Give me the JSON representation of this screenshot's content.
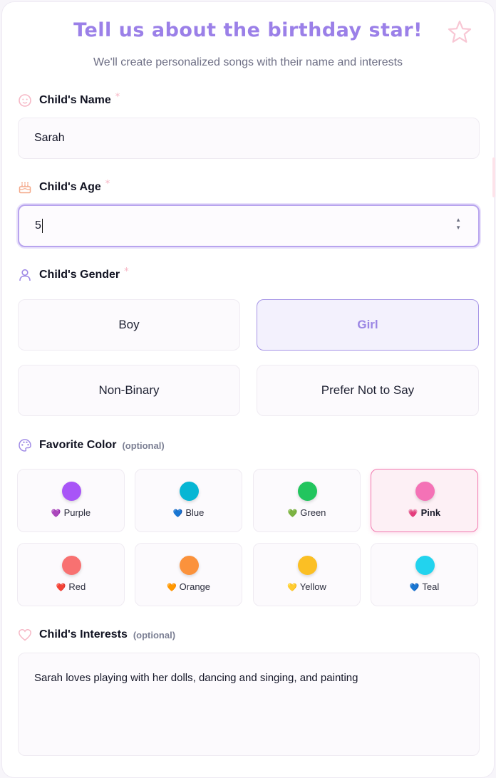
{
  "header": {
    "title": "Tell us about the birthday star!",
    "subtitle": "We'll create personalized songs with their name and interests"
  },
  "name_field": {
    "label": "Child's Name",
    "required_mark": "*",
    "value": "Sarah",
    "icon": "baby-face-icon"
  },
  "age_field": {
    "label": "Child's Age",
    "required_mark": "*",
    "value": "5",
    "icon": "cake-icon"
  },
  "gender_field": {
    "label": "Child's Gender",
    "required_mark": "*",
    "icon": "person-icon",
    "options": [
      "Boy",
      "Girl",
      "Non-Binary",
      "Prefer Not to Say"
    ],
    "selected": "Girl"
  },
  "color_field": {
    "label": "Favorite Color",
    "optional_mark": "(optional)",
    "icon": "palette-icon",
    "selected": "Pink",
    "options": [
      {
        "name": "Purple",
        "emoji": "💜",
        "color": "#a855f7"
      },
      {
        "name": "Blue",
        "emoji": "💙",
        "color": "#06b6d4"
      },
      {
        "name": "Green",
        "emoji": "💚",
        "color": "#22c55e"
      },
      {
        "name": "Pink",
        "emoji": "💗",
        "color": "#f472b6"
      },
      {
        "name": "Red",
        "emoji": "❤️",
        "color": "#f87171"
      },
      {
        "name": "Orange",
        "emoji": "🧡",
        "color": "#fb923c"
      },
      {
        "name": "Yellow",
        "emoji": "💛",
        "color": "#fbbf24"
      },
      {
        "name": "Teal",
        "emoji": "💙",
        "color": "#22d3ee"
      }
    ]
  },
  "interests_field": {
    "label": "Child's Interests",
    "optional_mark": "(optional)",
    "icon": "heart-icon",
    "value": "Sarah loves playing with her dolls, dancing and singing, and painting"
  },
  "colors": {
    "accent": "#9b80e8",
    "pink": "#f27bb0",
    "required": "#f7b4c3"
  }
}
